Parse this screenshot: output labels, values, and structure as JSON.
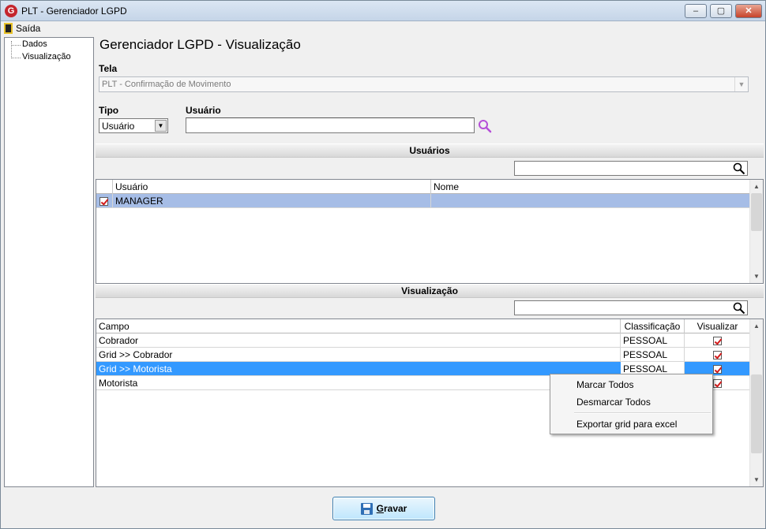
{
  "window": {
    "title": "PLT - Gerenciador LGPD",
    "app_icon": "G",
    "buttons": {
      "minimize": "‒",
      "maximize": "▢",
      "close": "✕"
    }
  },
  "menu": {
    "exit_label": "Saída"
  },
  "tree": {
    "items": [
      {
        "label": "Dados"
      },
      {
        "label": "Visualização"
      }
    ]
  },
  "page": {
    "title": "Gerenciador LGPD - Visualização"
  },
  "form": {
    "tela_label": "Tela",
    "tela_value": "PLT - Confirmação de Movimento",
    "tipo_label": "Tipo",
    "tipo_value": "Usuário",
    "usuario_label": "Usuário",
    "usuario_value": ""
  },
  "users_section": {
    "title": "Usuários",
    "filter_value": "",
    "columns": [
      "Usuário",
      "Nome"
    ],
    "rows": [
      {
        "checked": true,
        "usuario": "MANAGER",
        "nome": ""
      }
    ]
  },
  "visualizacao_section": {
    "title": "Visualização",
    "filter_value": "",
    "columns": [
      "Campo",
      "Classificação",
      "Visualizar"
    ],
    "rows": [
      {
        "campo": "Cobrador",
        "classificacao": "PESSOAL",
        "visualizar": true
      },
      {
        "campo": "Grid >> Cobrador",
        "classificacao": "PESSOAL",
        "visualizar": true
      },
      {
        "campo": "Grid >> Motorista",
        "classificacao": "PESSOAL",
        "visualizar": true,
        "selected": true
      },
      {
        "campo": "Motorista",
        "classificacao": "",
        "visualizar": true
      }
    ]
  },
  "context_menu": {
    "items": [
      "Marcar Todos",
      "Desmarcar Todos",
      "Exportar grid para excel"
    ]
  },
  "footer": {
    "save_label": "Gravar",
    "save_mnemonic": "G"
  },
  "colors": {
    "selected_row": "#3399ff",
    "user_row_selected": "#a6bde6",
    "check_red": "#d21b1b",
    "search_purple": "#b54fd8"
  }
}
